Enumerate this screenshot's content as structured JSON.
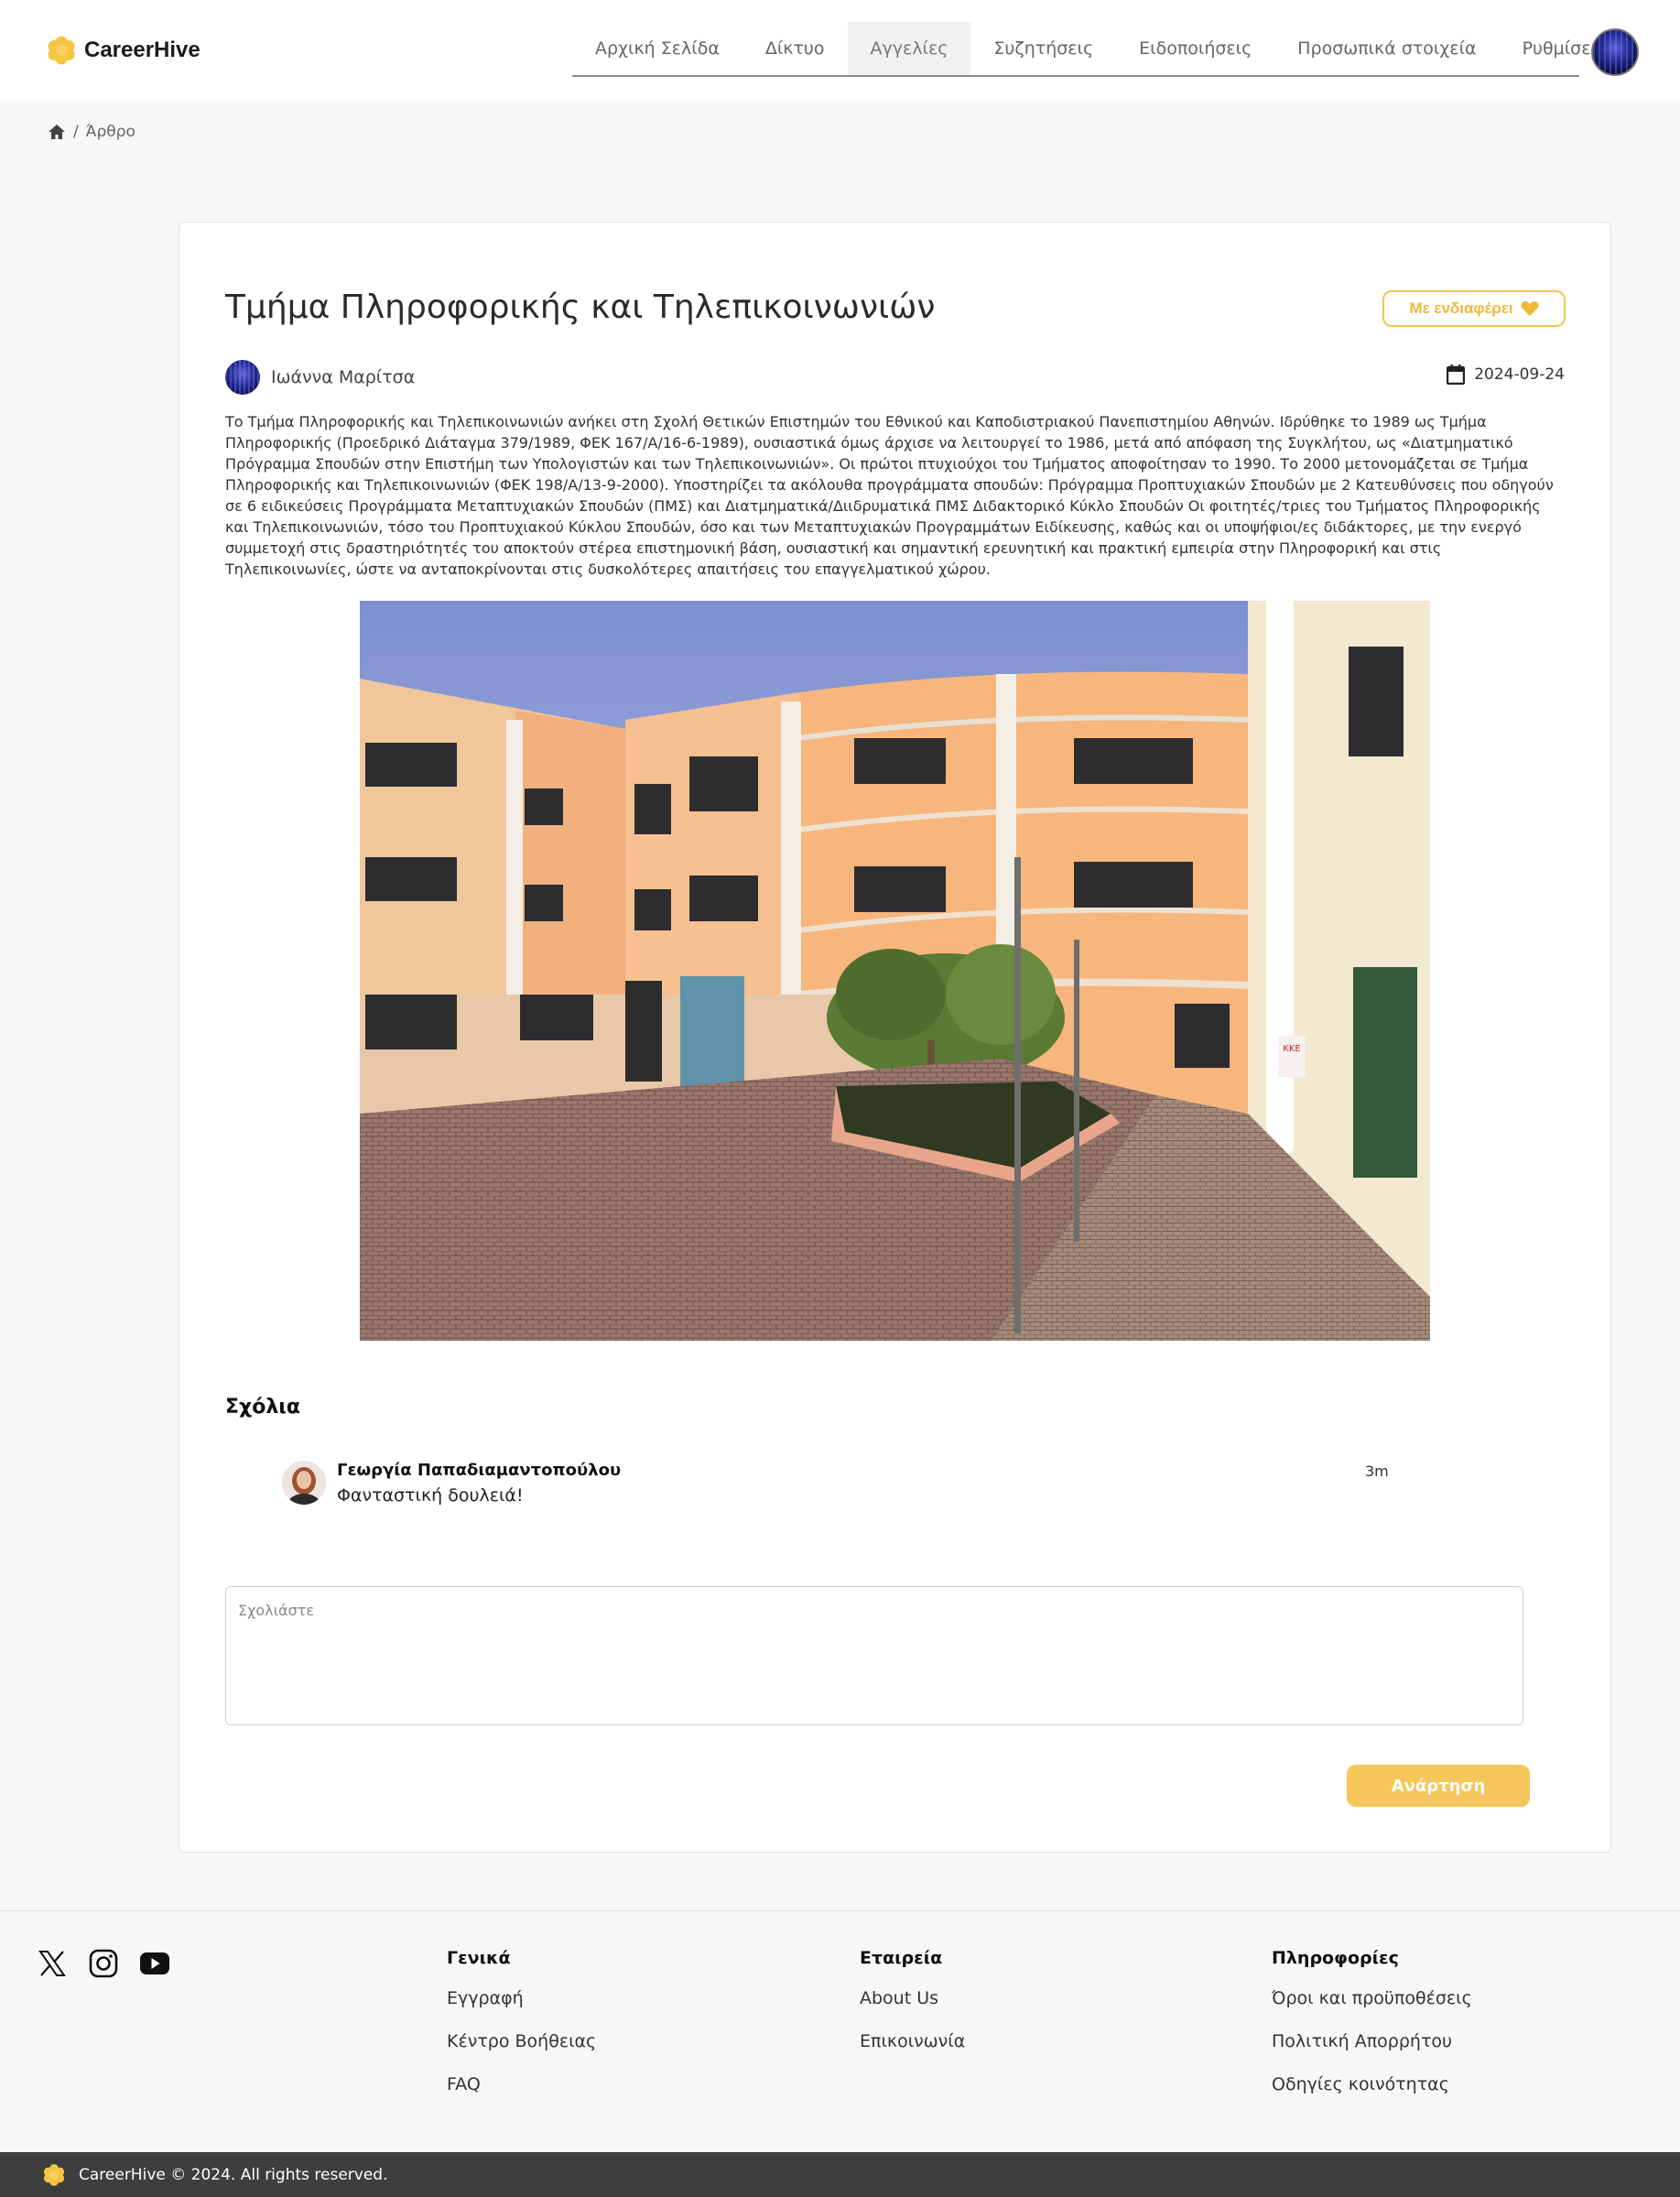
{
  "brand": {
    "name": "CareerHive",
    "accent": "#f5c542"
  },
  "nav": {
    "items": [
      {
        "label": "Αρχική Σελίδα"
      },
      {
        "label": "Δίκτυο"
      },
      {
        "label": "Αγγελίες"
      },
      {
        "label": "Συζητήσεις"
      },
      {
        "label": "Ειδοποιήσεις"
      },
      {
        "label": "Προσωπικά στοιχεία"
      },
      {
        "label": "Ρυθμίσεις"
      }
    ],
    "active_index": 2
  },
  "breadcrumb": {
    "home_icon": "home-icon",
    "separator": "/",
    "current": "Άρθρο"
  },
  "article": {
    "title": "Τμήμα Πληροφορικής και Τηλεπικοινωνιών",
    "interest_label": "Με ενδιαφέρει",
    "author": "Ιωάννα Μαρίτσα",
    "date": "2024-09-24",
    "body": "Το Τμήμα Πληροφορικής και Τηλεπικοινωνιών ανήκει στη Σχολή Θετικών Επιστημών του Εθνικού και Καποδιστριακού Πανεπιστημίου Αθηνών. Ιδρύθηκε το 1989 ως Τμήμα Πληροφορικής (Προεδρικό Διάταγμα 379/1989, ΦΕΚ 167/Α/16-6-1989), ουσιαστικά όμως άρχισε να λειτουργεί το 1986, μετά από απόφαση της Συγκλήτου, ως «Διατμηματικό Πρόγραμμα Σπουδών στην Επιστήμη των Υπολογιστών και των Τηλεπικοινωνιών». Οι πρώτοι πτυχιούχοι του Τμήματος αποφοίτησαν το 1990. Το 2000 μετονομάζεται σε Τμήμα Πληροφορικής και Τηλεπικοινωνιών (ΦΕΚ 198/Α/13-9-2000). Υποστηρίζει τα ακόλουθα προγράμματα σπουδών: Πρόγραμμα Προπτυχιακών Σπουδών με 2 Κατευθύνσεις που οδηγούν σε 6 ειδικεύσεις Προγράμματα Μεταπτυχιακών Σπουδών (ΠΜΣ) και Διατμηματικά/Διιδρυματικά ΠΜΣ Διδακτορικό Κύκλο Σπουδών Οι φοιτητές/τριες του Τμήματος Πληροφορικής και Τηλεπικοινωνιών, τόσο του Προπτυχιακού Κύκλου Σπουδών, όσο και των Μεταπτυχιακών Προγραμμάτων Ειδίκευσης, καθώς και οι υποψήφιοι/ες διδάκτορες, με την ενεργό συμμετοχή στις δραστηριότητές του αποκτούν στέρεα επιστημονική βάση, ουσιαστική και σημαντική ερευνητική και πρακτική εμπειρία στην Πληροφορική και στις Τηλεπικοινωνίες, ώστε να ανταποκρίνονται στις δυσκολότερες απαιτήσεις του επαγγελματικού χώρου.",
    "photo_sign": "ΚΚΕ"
  },
  "comments": {
    "title": "Σχόλια",
    "items": [
      {
        "author": "Γεωργία Παπαδιαμαντοπούλου",
        "text": "Φανταστική δουλειά!",
        "time": "3m"
      }
    ],
    "input_placeholder": "Σχολιάστε",
    "submit_label": "Ανάρτηση"
  },
  "footer": {
    "social_icons": [
      "x-icon",
      "instagram-icon",
      "youtube-icon"
    ],
    "columns": [
      {
        "heading": "Γενικά",
        "links": [
          "Εγγραφή",
          "Κέντρο Βοήθειας",
          "FAQ"
        ]
      },
      {
        "heading": "Εταιρεία",
        "links": [
          "About Us",
          "Επικοινωνία"
        ]
      },
      {
        "heading": "Πληροφορίες",
        "links": [
          "Όροι και προϋποθέσεις",
          "Πολιτική Απορρήτου",
          "Οδηγίες κοινότητας"
        ]
      }
    ],
    "copyright": "CareerHive © 2024. All rights reserved."
  }
}
